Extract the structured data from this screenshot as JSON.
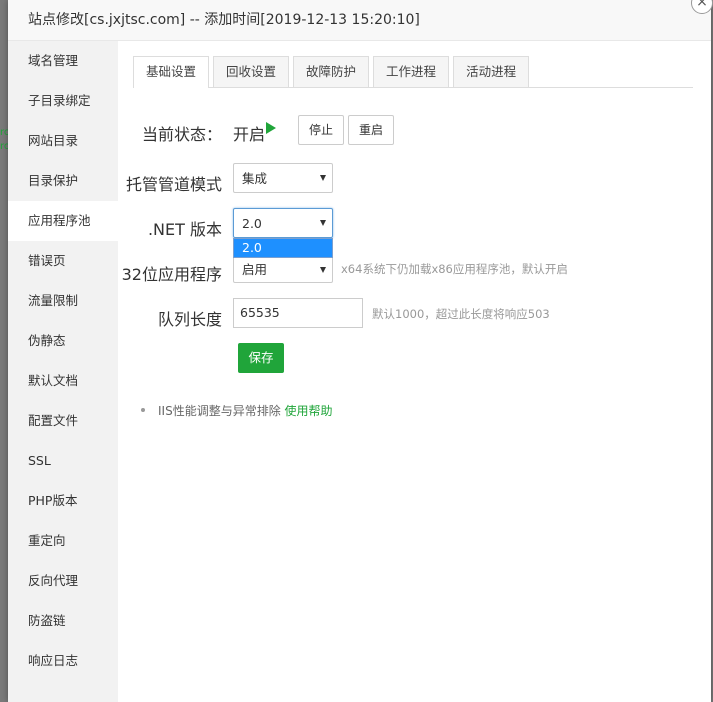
{
  "dialog": {
    "title": "站点修改[cs.jxjtsc.com] -- 添加时间[2019-12-13 15:20:10]",
    "close_icon": "close-icon"
  },
  "sidebar": {
    "items": [
      {
        "label": "域名管理"
      },
      {
        "label": "子目录绑定"
      },
      {
        "label": "网站目录"
      },
      {
        "label": "目录保护"
      },
      {
        "label": "应用程序池",
        "active": true
      },
      {
        "label": "错误页"
      },
      {
        "label": "流量限制"
      },
      {
        "label": "伪静态"
      },
      {
        "label": "默认文档"
      },
      {
        "label": "配置文件"
      },
      {
        "label": "SSL"
      },
      {
        "label": "PHP版本"
      },
      {
        "label": "重定向"
      },
      {
        "label": "反向代理"
      },
      {
        "label": "防盗链"
      },
      {
        "label": "响应日志"
      }
    ]
  },
  "tabs": [
    {
      "label": "基础设置",
      "active": true
    },
    {
      "label": "回收设置"
    },
    {
      "label": "故障防护"
    },
    {
      "label": "工作进程"
    },
    {
      "label": "活动进程"
    }
  ],
  "form": {
    "status": {
      "label": "当前状态：",
      "value": "开启",
      "icon": "play-icon",
      "stop_label": "停止",
      "restart_label": "重启"
    },
    "pipeline": {
      "label": "托管管道模式",
      "value": "集成"
    },
    "dotnet": {
      "label": ".NET 版本",
      "value": "2.0",
      "open_options": [
        "2.0"
      ]
    },
    "bit32": {
      "label": "32位应用程序",
      "value": "启用",
      "hint": "x64系统下仍加载x86应用程序池，默认开启"
    },
    "queue": {
      "label": "队列长度",
      "value": "65535",
      "hint": "默认1000，超过此长度将响应503"
    },
    "save_label": "保存"
  },
  "tip": {
    "text": "IIS性能调整与异常排除",
    "link": "使用帮助"
  },
  "colors": {
    "accent": "#20a53a",
    "focus": "#5b9bd5",
    "dropdown_highlight": "#1e90ff"
  }
}
